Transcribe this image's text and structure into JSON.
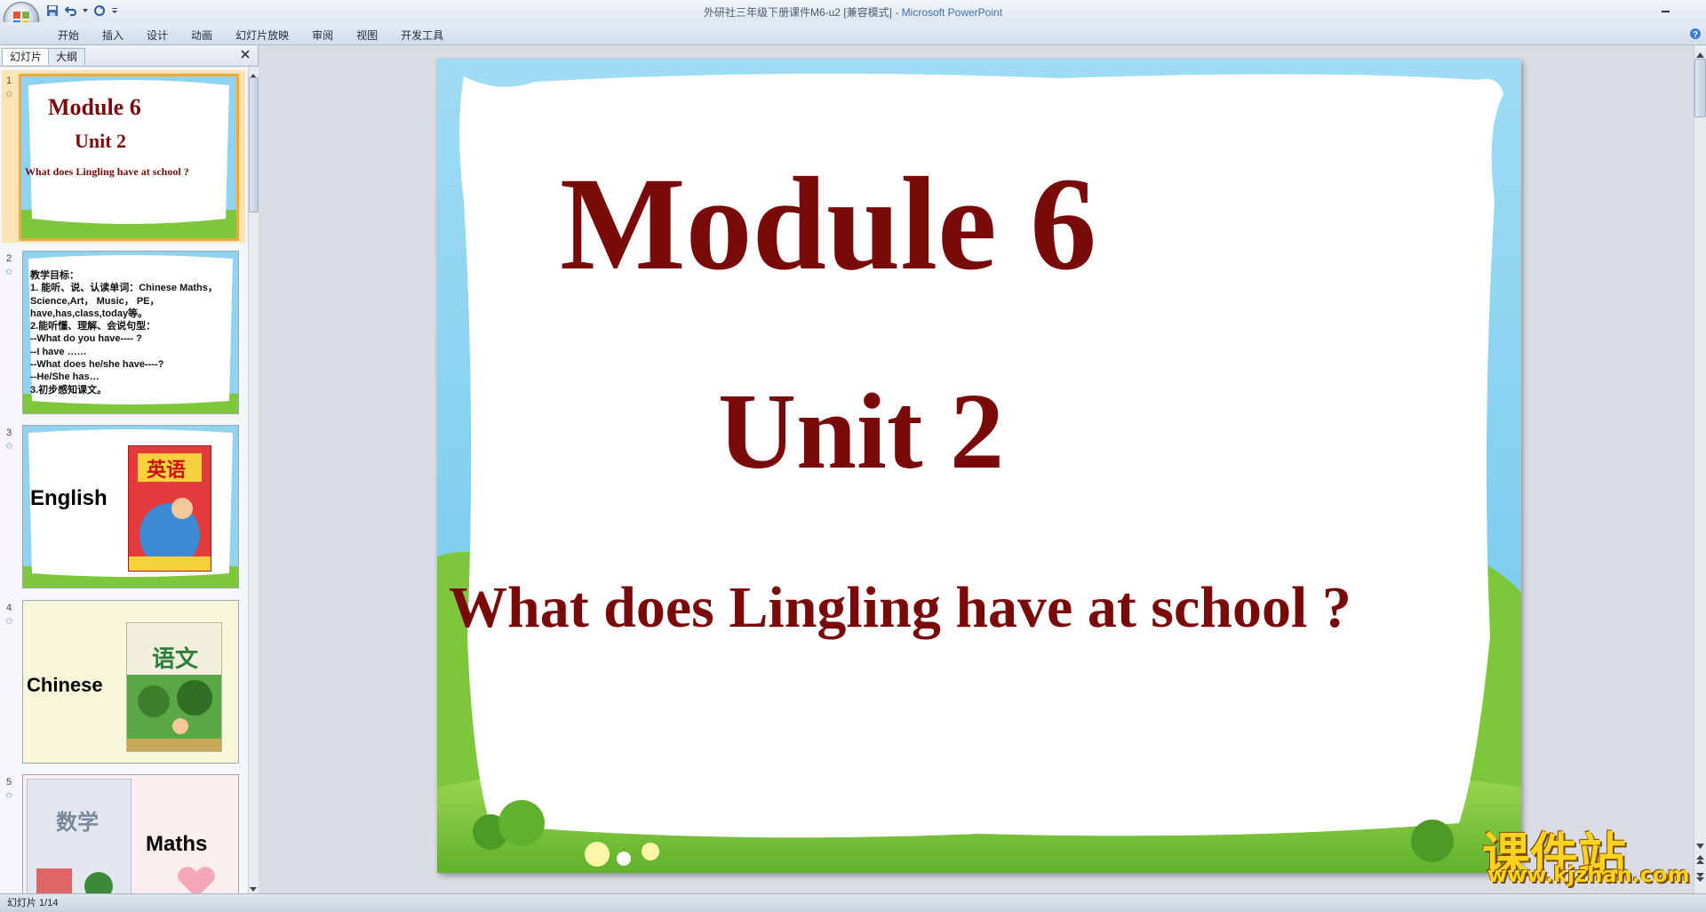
{
  "window": {
    "title": "外研社三年级下册课件M6-u2 [兼容模式]",
    "separator": " - ",
    "app_name": "Microsoft PowerPoint"
  },
  "ribbon": {
    "tabs": [
      "开始",
      "插入",
      "设计",
      "动画",
      "幻灯片放映",
      "审阅",
      "视图",
      "开发工具"
    ]
  },
  "left_pane": {
    "tabs": [
      "幻灯片",
      "大纲"
    ],
    "thumbnails": [
      {
        "number": "1",
        "lines": [
          "Module 6",
          "Unit 2",
          "What does Lingling have at school ?"
        ]
      },
      {
        "number": "2",
        "lines": [
          "教学目标：",
          "1. 能听、说、认读单词：Chinese Maths，",
          "Science,Art， Music， PE，",
          "have,has,class,today等。",
          "2.能听懂、理解、会说句型：",
          "--What do you have---- ?",
          "--I have ……",
          "--What does he/she have----?",
          "--He/She has…",
          "3.初步感知课文。"
        ]
      },
      {
        "number": "3",
        "label": "English",
        "book_title": "英语"
      },
      {
        "number": "4",
        "label": "Chinese",
        "book_title": "语文"
      },
      {
        "number": "5",
        "label": "Maths",
        "book_title": "数学"
      }
    ]
  },
  "slide": {
    "title": "Module 6",
    "subtitle": "Unit 2",
    "question": "What does Lingling have at school ?",
    "text_color": "#7a0a0a"
  },
  "watermark": {
    "brand": "课件站",
    "url": "www.kjzhan.com"
  },
  "status": {
    "slide_indicator": "幻灯片 1/14"
  },
  "colors": {
    "slide_sky": "#8fd3f0",
    "slide_grass": "#7cc83a",
    "selection": "#f2a93b"
  }
}
